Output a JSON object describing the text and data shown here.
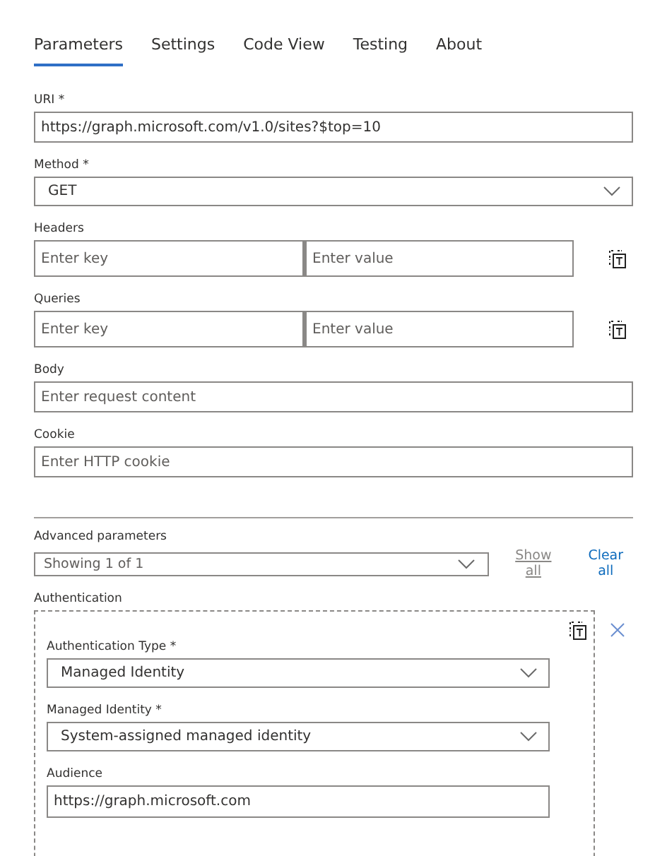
{
  "tabs": [
    {
      "label": "Parameters",
      "selected": true
    },
    {
      "label": "Settings",
      "selected": false
    },
    {
      "label": "Code View",
      "selected": false
    },
    {
      "label": "Testing",
      "selected": false
    },
    {
      "label": "About",
      "selected": false
    }
  ],
  "fields": [
    {
      "kind": "text",
      "label": "URI *",
      "value": "https://graph.microsoft.com/v1.0/sites?$top=10"
    },
    {
      "kind": "dropdown",
      "label": "Method *",
      "value": "GET"
    },
    {
      "kind": "keyvalue",
      "label": "Headers",
      "key_placeholder": "Enter key",
      "value_placeholder": "Enter value"
    },
    {
      "kind": "keyvalue",
      "label": "Queries",
      "key_placeholder": "Enter key",
      "value_placeholder": "Enter value"
    },
    {
      "kind": "text",
      "label": "Body",
      "placeholder": "Enter request content"
    },
    {
      "kind": "text",
      "label": "Cookie",
      "placeholder": "Enter HTTP cookie"
    }
  ],
  "advanced": {
    "label": "Advanced parameters",
    "value": "Showing 1 of 1",
    "links": [
      {
        "label": "Show all",
        "disabled": true
      },
      {
        "label": "Clear all",
        "disabled": false
      }
    ]
  },
  "authentication": {
    "label": "Authentication",
    "fields": [
      {
        "kind": "dropdown",
        "label": "Authentication Type *",
        "value": "Managed Identity"
      },
      {
        "kind": "dropdown",
        "label": "Managed Identity *",
        "value": "System-assigned managed identity"
      },
      {
        "kind": "text",
        "label": "Audience",
        "value": "https://graph.microsoft.com"
      }
    ]
  }
}
